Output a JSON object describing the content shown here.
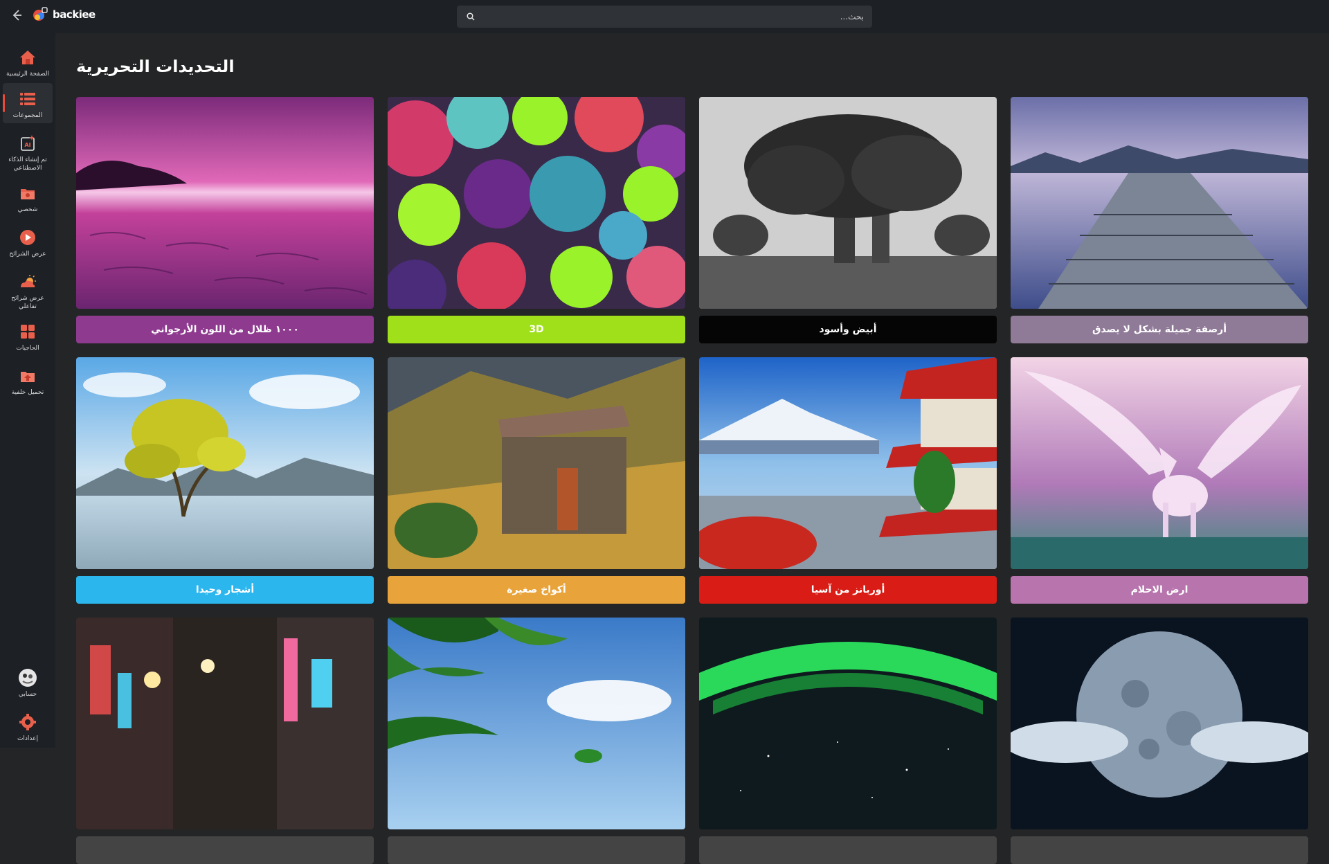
{
  "app": {
    "logo_text": "backiee"
  },
  "search": {
    "placeholder": "بحث..."
  },
  "sidebar": {
    "items": [
      {
        "label": "الصفحة الرئيسية",
        "icon": "home-icon"
      },
      {
        "label": "المجموعات",
        "icon": "collections-icon",
        "active": true
      },
      {
        "label": "تم إنشاء الذكاء الاصطناعي",
        "icon": "ai-generated-icon"
      },
      {
        "label": "شخصي",
        "icon": "personal-folder-icon"
      },
      {
        "label": "عرض الشرائح",
        "icon": "slideshow-icon"
      },
      {
        "label": "عرض شرائح تفاعلي",
        "icon": "interactive-slideshow-icon"
      },
      {
        "label": "الحاجيات",
        "icon": "widgets-icon"
      },
      {
        "label": "تحميل خلفية",
        "icon": "upload-wallpaper-icon"
      }
    ],
    "bottom": [
      {
        "label": "حسابي",
        "icon": "avatar"
      },
      {
        "label": "إعدادات",
        "icon": "gear-icon"
      }
    ],
    "accent_color": "#e84a3c"
  },
  "page": {
    "title": "التحديدات التحريرية"
  },
  "collections": [
    {
      "label": "١٠٠٠ ظلال من اللون الأرجواني",
      "color": "#8e3a8f"
    },
    {
      "label": "3D",
      "color": "#9fe01a"
    },
    {
      "label": "أبيض وأسود",
      "color": "#050505"
    },
    {
      "label": "أرصفة جميلة بشكل لا يصدق",
      "color": "#8f7a97"
    },
    {
      "label": "أشجار وحيدا",
      "color": "#2cb6ee"
    },
    {
      "label": "أكواخ صغيرة",
      "color": "#e8a43b"
    },
    {
      "label": "أوربانز من آسيا",
      "color": "#d91d16"
    },
    {
      "label": "ارض الاحلام",
      "color": "#b774ad"
    },
    {
      "label": "",
      "color": "#444"
    },
    {
      "label": "",
      "color": "#444"
    },
    {
      "label": "",
      "color": "#444"
    },
    {
      "label": "",
      "color": "#444"
    }
  ]
}
